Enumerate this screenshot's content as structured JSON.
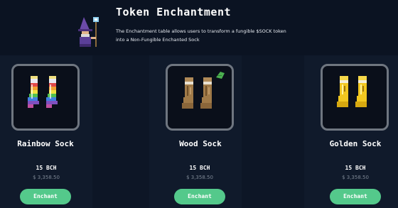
{
  "header": {
    "title": "Token Enchantment",
    "description": "The Enchantment table allows users to transform a fungible $SOCK token into a Non-Fungible Enchanted Sock",
    "wizard_icon": "wizard-icon"
  },
  "cards": [
    {
      "name": "Rainbow Sock",
      "icon": "rainbow-sock-icon",
      "price": "15 BCH",
      "usd": "$ 3,358.50",
      "button_label": "Enchant"
    },
    {
      "name": "Wood Sock",
      "icon": "wood-sock-icon",
      "price": "15 BCH",
      "usd": "$ 3,358.50",
      "button_label": "Enchant"
    },
    {
      "name": "Golden Sock",
      "icon": "golden-sock-icon",
      "price": "15 BCH",
      "usd": "$ 3,358.50",
      "button_label": "Enchant"
    }
  ],
  "colors": {
    "background": "#0b1322",
    "card": "#101a2b",
    "button": "#54c98b",
    "image_border": "#6f7680"
  }
}
